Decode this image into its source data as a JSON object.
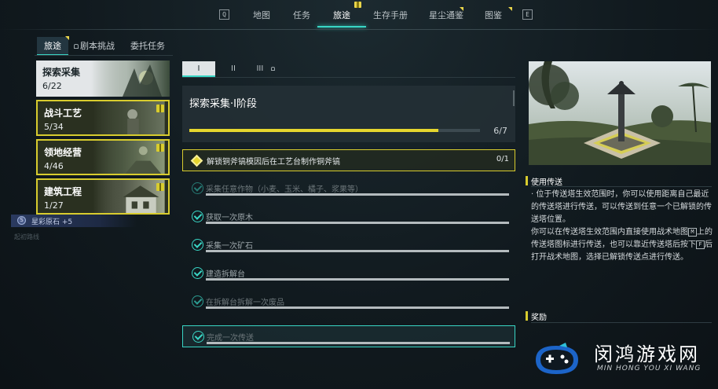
{
  "nav": {
    "left_key": "Q",
    "right_key": "E",
    "tabs": [
      {
        "label": "地图"
      },
      {
        "label": "任务"
      },
      {
        "label": "旅途"
      },
      {
        "label": "生存手册"
      },
      {
        "label": "星尘通鉴"
      },
      {
        "label": "图鉴"
      }
    ],
    "active_tab": "旅途"
  },
  "subtabs": {
    "items": [
      {
        "label": "旅途"
      },
      {
        "label": "剧本挑战"
      },
      {
        "label": "委托任务"
      }
    ]
  },
  "categories": [
    {
      "title": "探索采集",
      "count": "6/22"
    },
    {
      "title": "战斗工艺",
      "count": "5/34"
    },
    {
      "title": "领地经营",
      "count": "4/46"
    },
    {
      "title": "建筑工程",
      "count": "1/27"
    }
  ],
  "reward_strip": {
    "coin_glyph": "S",
    "text": "星彩原石 +5"
  },
  "faint_label": "起初路线",
  "stages": {
    "tabs": [
      "I",
      "II",
      "III"
    ]
  },
  "stage": {
    "name": "探索采集·I阶段",
    "progress_text": "6/7",
    "completed": 6,
    "total": 7
  },
  "tasks": [
    {
      "label": "解锁铜斧镐模因后在工艺台制作铜斧镐",
      "count": "0/1"
    },
    {
      "label": "采集任意作物（小麦、玉米、橘子、浆果等）"
    },
    {
      "label": "获取一次原木"
    },
    {
      "label": "采集一次矿石"
    },
    {
      "label": "建造拆解台"
    },
    {
      "label": "在拆解台拆解一次废品"
    },
    {
      "label": "完成一次传送"
    }
  ],
  "detail": {
    "section1_title": "使用传送",
    "desc1": "· 位于传送塔生效范围时，你可以使用距离自己最近的传送塔进行传送，可以传送到任意一个已解锁的传送塔位置。",
    "desc2_a": "你可以在传送塔生效范围内直接使用战术地图",
    "key_m": "M",
    "desc2_b": "上的传送塔图标进行传送，也可以靠近传送塔后按下",
    "key_f": "F",
    "desc2_c": "后打开战术地图，选择已解锁传送点进行传送。",
    "section2_title": "奖励"
  },
  "watermark": {
    "cn": "闵鸿游戏网",
    "en": "MIN HONG YOU XI WANG"
  },
  "colors": {
    "accent": "#39d6c5",
    "highlight": "#d8cc2e"
  }
}
